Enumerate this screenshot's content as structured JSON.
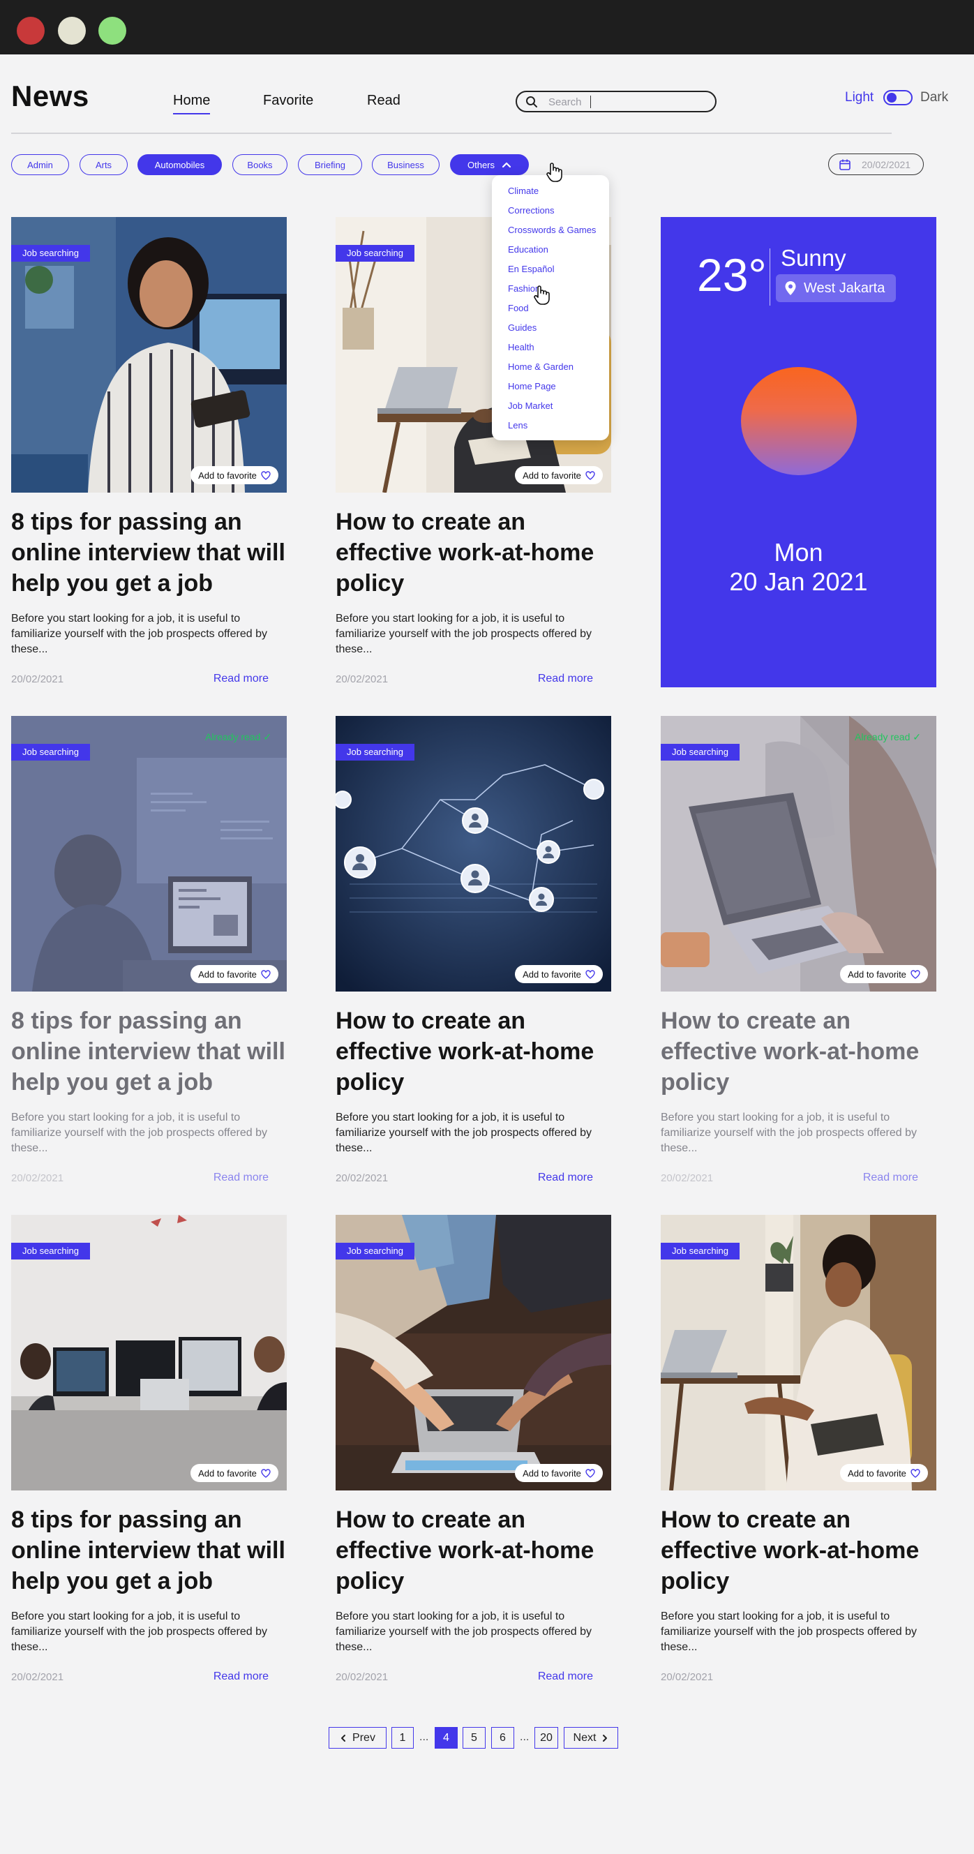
{
  "app": {
    "logo": "News"
  },
  "nav": {
    "home": "Home",
    "favorite": "Favorite",
    "read": "Read"
  },
  "search": {
    "placeholder": "Search"
  },
  "theme": {
    "light": "Light",
    "dark": "Dark",
    "selected": "Light"
  },
  "categories": {
    "chips": [
      "Admin",
      "Arts",
      "Automobiles",
      "Books",
      "Briefing",
      "Business"
    ],
    "selected": "Automobiles",
    "others": "Others",
    "dropdown": [
      "Climate",
      "Corrections",
      "Crosswords & Games",
      "Education",
      "En Español",
      "Fashion",
      "Food",
      "Guides",
      "Health",
      "Home & Garden",
      "Home Page",
      "Job Market",
      "Lens"
    ]
  },
  "date_filter": {
    "value": "20/02/2021"
  },
  "weather": {
    "temp": "23°",
    "condition": "Sunny",
    "location": "West Jakarta",
    "day": "Mon",
    "date": "20 Jan 2021"
  },
  "articles": [
    {
      "badge": "Job searching",
      "title": "8 tips for passing an online interview that will help you get a job",
      "desc": "Before you start looking for a job, it is useful to familiarize yourself with the job prospects offered by these...",
      "date": "20/02/2021",
      "read_more": "Read more",
      "favorite": "Add to favorite"
    },
    {
      "badge": "Job searching",
      "title": "How to create an effective work-at-home policy",
      "desc": "Before you start looking for a job, it is useful to familiarize yourself with the job prospects offered by these...",
      "date": "20/02/2021",
      "read_more": "Read more",
      "favorite": "Add to favorite"
    },
    {
      "badge": "Job searching",
      "title": "8 tips for passing an online interview that will help you get a job",
      "desc": "Before you start looking for a job, it is useful to familiarize yourself with the job prospects offered by these...",
      "date": "20/02/2021",
      "read_more": "Read more",
      "favorite": "Add to favorite",
      "status": "Already read"
    },
    {
      "badge": "Job searching",
      "title": "How to create an effective work-at-home policy",
      "desc": "Before you start looking for a job, it is useful to familiarize yourself with the job prospects offered by these...",
      "date": "20/02/2021",
      "read_more": "Read more",
      "favorite": "Add to favorite"
    },
    {
      "badge": "Job searching",
      "title": "How to create an effective work-at-home policy",
      "desc": "Before you start looking for a job, it is useful to familiarize yourself with the job prospects offered by these...",
      "date": "20/02/2021",
      "read_more": "Read more",
      "favorite": "Add to favorite",
      "status": "Already read"
    },
    {
      "badge": "Job searching",
      "title": "8 tips for passing an online interview that will help you get a job",
      "desc": "Before you start looking for a job, it is useful to familiarize yourself with the job prospects offered by these...",
      "date": "20/02/2021",
      "read_more": "Read more",
      "favorite": "Add to favorite"
    },
    {
      "badge": "Job searching",
      "title": "How to create an effective work-at-home policy",
      "desc": "Before you start looking for a job, it is useful to familiarize yourself with the job prospects offered by these...",
      "date": "20/02/2021",
      "read_more": "Read more",
      "favorite": "Add to favorite"
    },
    {
      "badge": "Job searching",
      "title": "How to create an effective work-at-home policy",
      "desc": "Before you start looking for a job, it is useful to familiarize yourself with the job prospects offered by these...",
      "date": "20/02/2021",
      "favorite": "Add to favorite"
    }
  ],
  "pagination": {
    "prev": "Prev",
    "next": "Next",
    "ellipsis": "...",
    "pages": [
      "1",
      "4",
      "5",
      "6",
      "20"
    ],
    "current": "4"
  },
  "colors": {
    "accent": "#4337ea",
    "read_badge": "#22c55e",
    "titlebar": "#1e1e1e"
  }
}
